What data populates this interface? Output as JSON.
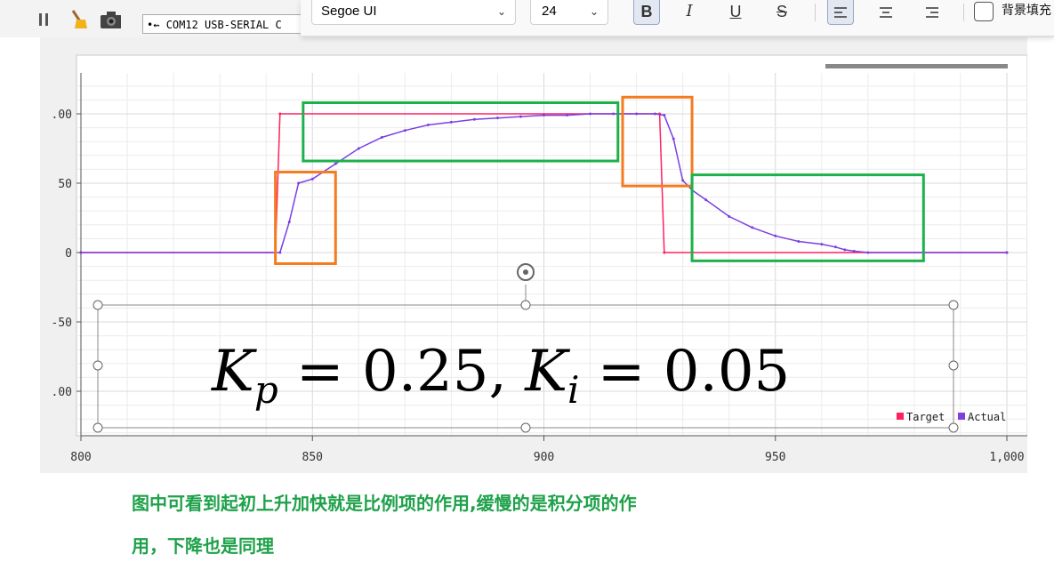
{
  "toolbar": {
    "port_label": "COM12 USB-SERIAL C",
    "icons": [
      "stop-icon",
      "broom-icon",
      "camera-icon",
      "usb-icon"
    ]
  },
  "format_bar": {
    "font_family_value": "Segoe UI",
    "font_size_value": "24",
    "chevron": "⌄",
    "bold_label": "B",
    "italic_label": "I",
    "underline_label": "U",
    "strike_label": "S",
    "align_left_active": true,
    "background_fill_label": "背景填充",
    "background_fill_checked": false
  },
  "formula": {
    "text": "Kp = 0.25, Ki = 0.05",
    "k": "K",
    "p": "p",
    "eq1": " = 0.25, ",
    "i": "i",
    "eq2": " = 0.05"
  },
  "caption": {
    "line1": "图中可看到起初上升加快就是比例项的作用,缓慢的是积分项的作",
    "line2": "用，下降也是同理"
  },
  "chart_data": {
    "type": "line",
    "x_ticks": [
      "800",
      "850",
      "900",
      "950",
      "1,000"
    ],
    "y_ticks": [
      ".00",
      "50",
      "0",
      "-50",
      ".00"
    ],
    "xlim": [
      800,
      1000
    ],
    "ylim": [
      -120,
      120
    ],
    "grid": true,
    "legend_position": "bottom-right",
    "series": [
      {
        "name": "Target",
        "color": "#ff2060",
        "x": [
          800,
          842,
          843,
          925,
          926,
          1000
        ],
        "y": [
          0,
          0,
          100,
          100,
          0,
          0
        ]
      },
      {
        "name": "Actual",
        "color": "#7b3fe4",
        "x": [
          800,
          843,
          845,
          847,
          850,
          855,
          860,
          865,
          870,
          875,
          880,
          885,
          890,
          895,
          900,
          905,
          910,
          915,
          920,
          924,
          926,
          928,
          930,
          932,
          935,
          940,
          945,
          950,
          955,
          960,
          963,
          965,
          967,
          970,
          1000
        ],
        "y": [
          0,
          0,
          22,
          50,
          53,
          64,
          75,
          83,
          88,
          92,
          94,
          96,
          97,
          98,
          99,
          99,
          100,
          100,
          100,
          100,
          99,
          82,
          52,
          45,
          38,
          26,
          18,
          12,
          8,
          6,
          4,
          2,
          1,
          0,
          0
        ]
      }
    ],
    "annotations": [
      {
        "type": "box",
        "color": "#f47b20",
        "x": [
          842,
          855
        ],
        "y": [
          -8,
          58
        ]
      },
      {
        "type": "box",
        "color": "#1db14b",
        "x": [
          848,
          916
        ],
        "y": [
          66,
          108
        ]
      },
      {
        "type": "box",
        "color": "#f47b20",
        "x": [
          917,
          932
        ],
        "y": [
          48,
          112
        ]
      },
      {
        "type": "box",
        "color": "#1db14b",
        "x": [
          932,
          982
        ],
        "y": [
          -6,
          56
        ]
      }
    ]
  }
}
